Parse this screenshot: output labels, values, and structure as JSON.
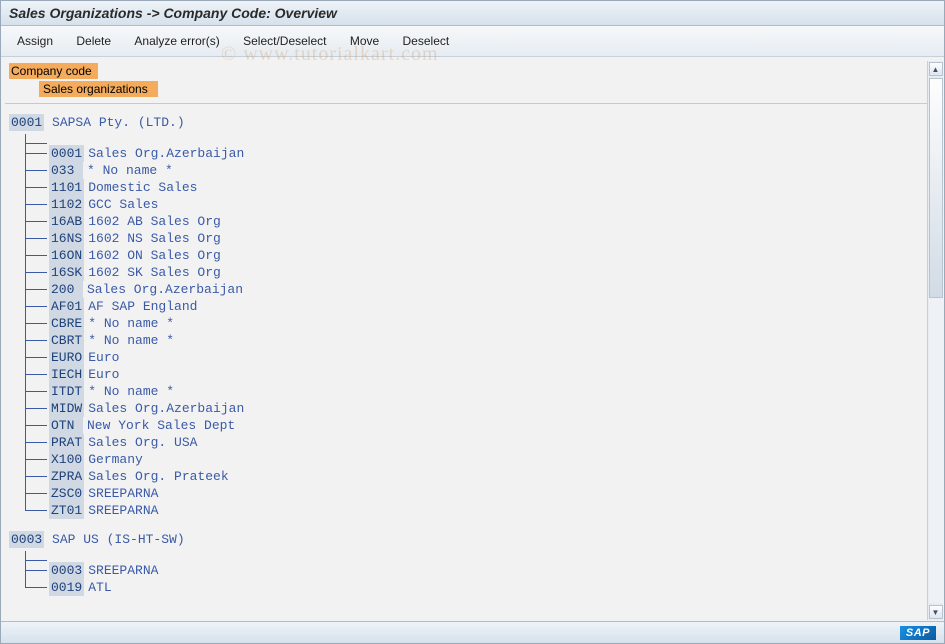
{
  "title": "Sales Organizations -> Company Code: Overview",
  "menu": {
    "assign": "Assign",
    "delete": "Delete",
    "analyze": "Analyze error(s)",
    "select": "Select/Deselect",
    "move": "Move",
    "deselect": "Deselect"
  },
  "legend": {
    "line1": "Company code",
    "line2": "Sales organizations"
  },
  "watermark": "© www.tutorialkart.com",
  "footer": {
    "logo": "SAP"
  },
  "tree": [
    {
      "code": "0001",
      "name": "SAPSA Pty. (LTD.)",
      "children": [
        {
          "code": "0001",
          "name": "Sales Org.Azerbaijan"
        },
        {
          "code": "033",
          "name": "* No name *"
        },
        {
          "code": "1101",
          "name": "Domestic Sales"
        },
        {
          "code": "1102",
          "name": "GCC Sales"
        },
        {
          "code": "16AB",
          "name": "1602 AB Sales Org"
        },
        {
          "code": "16NS",
          "name": "1602 NS Sales Org"
        },
        {
          "code": "16ON",
          "name": "1602 ON Sales Org"
        },
        {
          "code": "16SK",
          "name": "1602 SK Sales Org"
        },
        {
          "code": "200",
          "name": "Sales Org.Azerbaijan"
        },
        {
          "code": "AF01",
          "name": "AF SAP England"
        },
        {
          "code": "CBRE",
          "name": "* No name *"
        },
        {
          "code": "CBRT",
          "name": "* No name *"
        },
        {
          "code": "EURO",
          "name": "Euro"
        },
        {
          "code": "IECH",
          "name": "Euro"
        },
        {
          "code": "ITDT",
          "name": "* No name *"
        },
        {
          "code": "MIDW",
          "name": "Sales Org.Azerbaijan"
        },
        {
          "code": "OTN",
          "name": "New York Sales Dept"
        },
        {
          "code": "PRAT",
          "name": "Sales Org. USA"
        },
        {
          "code": "X100",
          "name": "Germany"
        },
        {
          "code": "ZPRA",
          "name": "Sales Org. Prateek"
        },
        {
          "code": "ZSC0",
          "name": "SREEPARNA"
        },
        {
          "code": "ZT01",
          "name": "SREEPARNA"
        }
      ]
    },
    {
      "code": "0003",
      "name": "SAP US (IS-HT-SW)",
      "children": [
        {
          "code": "0003",
          "name": "SREEPARNA"
        },
        {
          "code": "0019",
          "name": "ATL"
        }
      ]
    }
  ]
}
